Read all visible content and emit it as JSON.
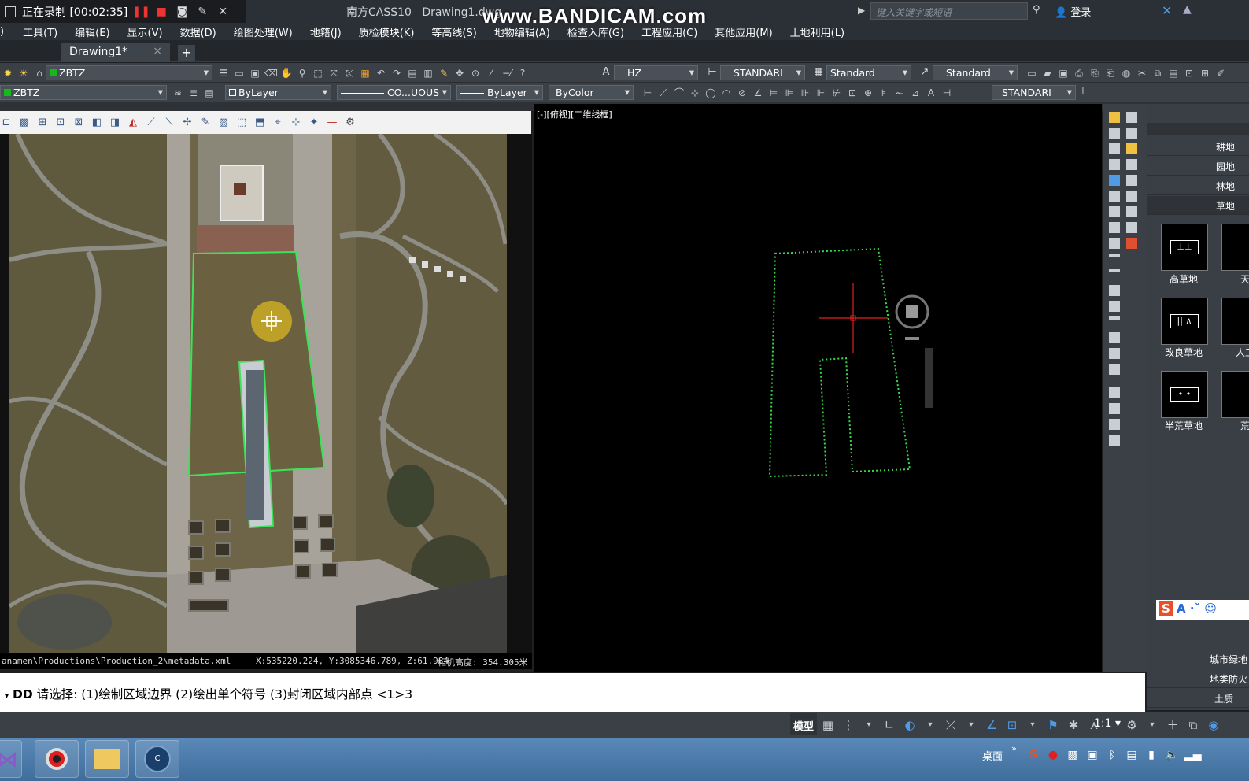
{
  "recorder": {
    "status": "正在录制 [00:02:35]",
    "watermark": "www.BANDICAM.com"
  },
  "app": {
    "title": "南方CASS10",
    "document": "Drawing1.dwg",
    "search_placeholder": "键入关键字或短语",
    "login_label": "登录"
  },
  "menu": {
    "items": [
      ")",
      "工具(T)",
      "编辑(E)",
      "显示(V)",
      "数据(D)",
      "绘图处理(W)",
      "地籍(J)",
      "质检模块(K)",
      "等高线(S)",
      "地物编辑(A)",
      "检查入库(G)",
      "工程应用(C)",
      "其他应用(M)",
      "土地利用(L)"
    ]
  },
  "tabs": {
    "active": "Drawing1*",
    "close": "×",
    "add": "+"
  },
  "toolbar1": {
    "layer": "ZBTZ",
    "text_style": "HZ",
    "dim_style": "STANDARI",
    "table_style": "Standard",
    "multileader_style": "Standard"
  },
  "toolbar2": {
    "layer": "ZBTZ",
    "color": "ByLayer",
    "linetype": "CO...UOUS",
    "lineweight": "ByLayer",
    "plotstyle": "ByColor",
    "dim_style": "STANDARI"
  },
  "image_panel": {
    "status_path": "anamen\\Productions\\Production_2\\metadata.xml",
    "status_coords": "X:535220.224, Y:3085346.789, Z:61.984",
    "status_height": "相机高度: 354.305米"
  },
  "viewport": {
    "label": "[-][俯视][二维线框]"
  },
  "palette": {
    "categories": [
      "耕地",
      "园地",
      "林地",
      "草地"
    ],
    "symbols": [
      {
        "label": "高草地",
        "glyph": "⊥⊥"
      },
      {
        "label": "天",
        "glyph": ""
      },
      {
        "label": "改良草地",
        "glyph": "|| ∧"
      },
      {
        "label": "人工",
        "glyph": ""
      },
      {
        "label": "半荒草地",
        "glyph": "• •"
      },
      {
        "label": "荒",
        "glyph": ""
      }
    ],
    "bottom_categories": [
      "城市绿地",
      "地类防火",
      "土质"
    ]
  },
  "command": {
    "prefix": "DD",
    "prompt": "请选择: (1)绘制区域边界 (2)绘出单个符号 (3)封闭区域内部点 <1>3"
  },
  "status": {
    "model": "模型",
    "scale": "1:1"
  },
  "taskbar": {
    "desktop_label": "桌面"
  },
  "colors": {
    "cad_background": "#000000",
    "boundary": "#39d84a",
    "crosshair": "#e02020",
    "record_red": "#e33333"
  }
}
